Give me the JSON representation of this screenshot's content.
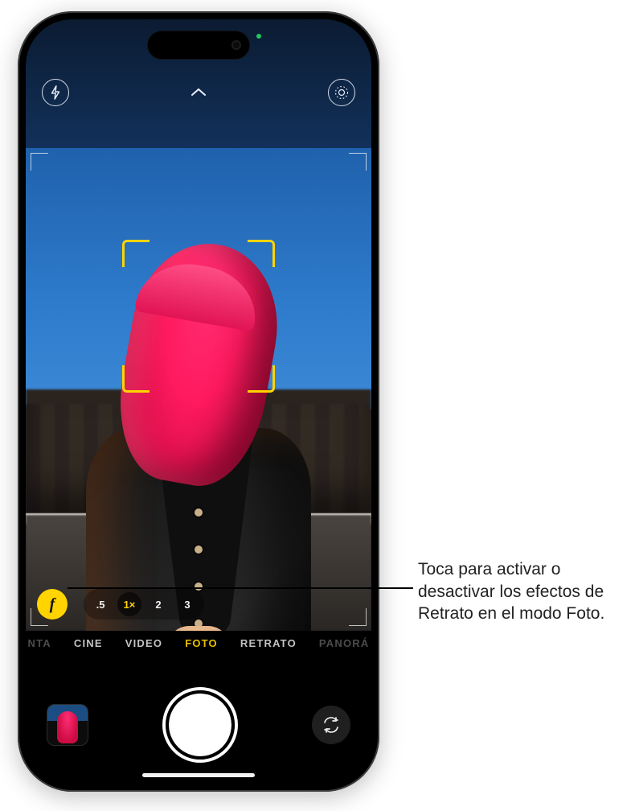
{
  "callout": {
    "text": "Toca para activar o desactivar los efectos de Retrato en el modo Foto."
  },
  "topbar": {
    "flash_icon": "flash-icon",
    "chevron_icon": "chevron-up-icon",
    "live_icon": "live-photo-icon"
  },
  "depth_button": {
    "glyph": "f"
  },
  "zoom": {
    "levels": [
      ".5",
      "1×",
      "2",
      "3"
    ],
    "active_index": 1
  },
  "modes": {
    "items": [
      "NTA",
      "CINE",
      "VIDEO",
      "FOTO",
      "RETRATO",
      "PANORÁ"
    ],
    "active_index": 3,
    "edge_indices": [
      0,
      5
    ]
  },
  "controls": {
    "thumbnail": "last-photo-thumbnail",
    "shutter": "shutter-button",
    "flip": "switch-camera-icon"
  }
}
